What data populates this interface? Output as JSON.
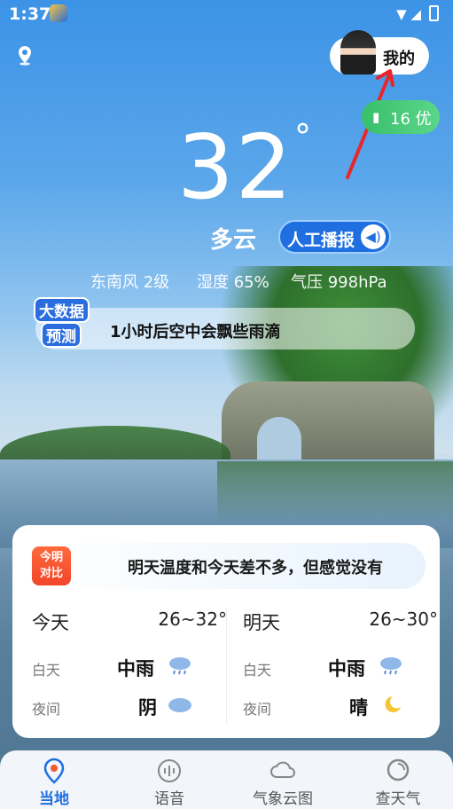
{
  "status": {
    "time": "1:37"
  },
  "header": {
    "mine_label": "我的"
  },
  "aqi": {
    "text": "16 优"
  },
  "weather": {
    "temp": "32",
    "degree_symbol": "°",
    "condition": "多云",
    "broadcast_label": "人工播报",
    "wind": "东南风 2级",
    "humidity": "湿度 65%",
    "pressure": "气压 998hPa"
  },
  "forecast": {
    "badge_line1": "大数据",
    "badge_line2": "预测",
    "message": "1小时后空中会飘些雨滴"
  },
  "compare": {
    "tag_line1": "今明",
    "tag_line2": "对比",
    "text": "明天温度和今天差不多，但感觉没有"
  },
  "today": {
    "label": "今天",
    "range": "26~32°",
    "day_key": "白天",
    "day_value": "中雨",
    "night_key": "夜间",
    "night_value": "阴"
  },
  "tomorrow": {
    "label": "明天",
    "range": "26~30°",
    "day_key": "白天",
    "day_value": "中雨",
    "night_key": "夜间",
    "night_value": "晴"
  },
  "tabs": [
    {
      "label": "当地"
    },
    {
      "label": "语音"
    },
    {
      "label": "气象云图"
    },
    {
      "label": "查天气"
    }
  ],
  "colors": {
    "accent": "#1f6fe0",
    "aqi_green": "#38c06a"
  }
}
